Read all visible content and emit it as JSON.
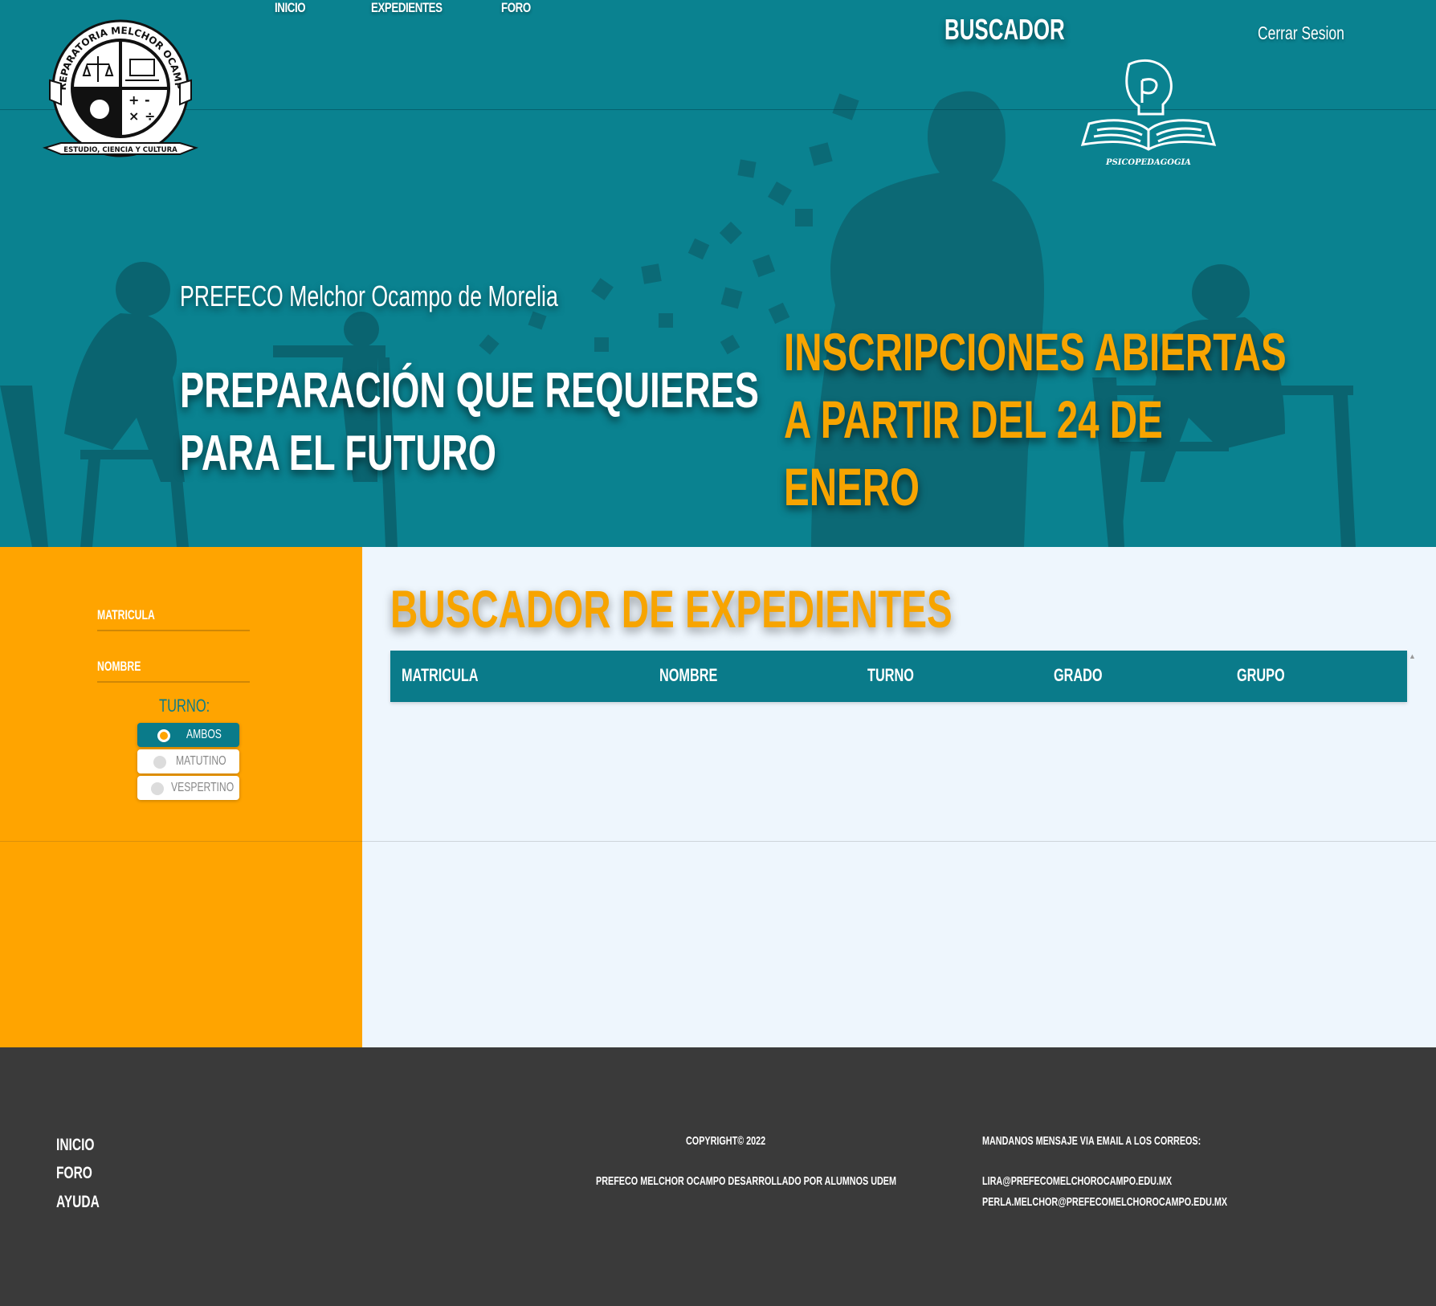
{
  "logo": {
    "arc_text": "PREPARATORIA MELCHOR OCAMPO",
    "banner_text": "ESTUDIO, CIENCIA Y CULTURA"
  },
  "nav": {
    "items": [
      {
        "label": "INICIO"
      },
      {
        "label": "EXPEDIENTES"
      },
      {
        "label": "FORO"
      }
    ],
    "section_title": "BUSCADOR",
    "logout": "Cerrar Sesion"
  },
  "psico_logo": {
    "text": "PSICOPEDAGOGIA"
  },
  "hero": {
    "subtitle": "PREFECO Melchor Ocampo de Morelia",
    "headline": "PREPARACIÓN QUE REQUIERES PARA EL FUTURO",
    "promo": "INSCRIPCIONES ABIERTAS A PARTIR DEL 24 DE ENERO"
  },
  "search": {
    "fields": [
      {
        "label": "MATRICULA"
      },
      {
        "label": "NOMBRE"
      }
    ],
    "turno_label": "TURNO:",
    "turno_options": [
      {
        "label": "AMBOS",
        "selected": true
      },
      {
        "label": "MATUTINO",
        "selected": false
      },
      {
        "label": "VESPERTINO",
        "selected": false
      }
    ]
  },
  "results": {
    "title": "BUSCADOR DE EXPEDIENTES",
    "columns": [
      "MATRICULA",
      "NOMBRE",
      "TURNO",
      "GRADO",
      "GRUPO"
    ],
    "rows": []
  },
  "footer": {
    "links": [
      "INICIO",
      "FORO",
      "AYUDA"
    ],
    "copyright": "COPYRIGHT© 2022",
    "credits": "PREFECO MELCHOR OCAMPO DESARROLLADO POR ALUMNOS UDEM",
    "contact_title": "MANDANOS MENSAJE VIA EMAIL A LOS CORREOS:",
    "emails": [
      "LIRA@PREFECOMELCHOROCAMPO.EDU.MX",
      "PERLA.MELCHOR@PREFECOMELCHOROCAMPO.EDU.MX"
    ]
  },
  "colors": {
    "teal": "#0a8290",
    "teal_dark": "#0a7b8a",
    "orange": "#ffa400",
    "title_orange": "#f7a400",
    "content_bg": "#eef6fd",
    "footer_bg": "#3a3a3a"
  }
}
